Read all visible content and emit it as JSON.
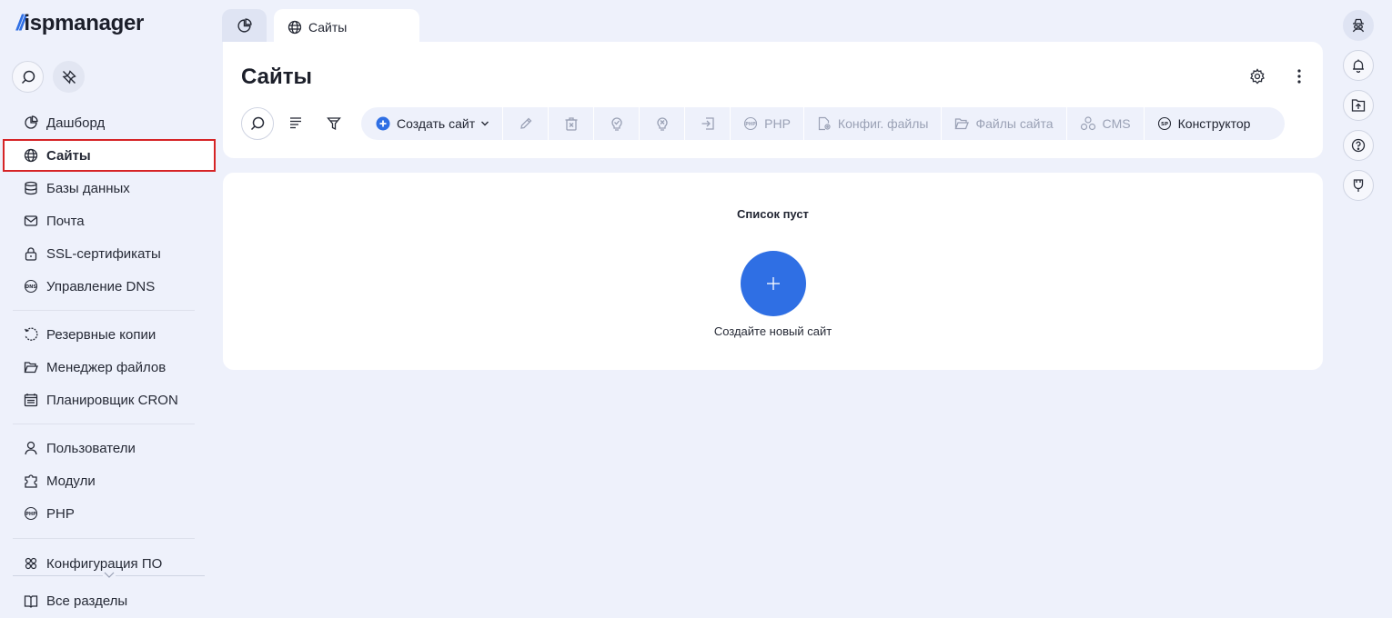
{
  "brand": {
    "slashes": "//",
    "name": "ispmanager"
  },
  "sidebar": {
    "tools": [
      {
        "icon": "search-icon"
      },
      {
        "icon": "pin-icon"
      }
    ],
    "items": [
      {
        "id": "dashboard",
        "label": "Дашборд",
        "icon": "pie-chart-icon"
      },
      {
        "id": "sites",
        "label": "Сайты",
        "icon": "globe-icon",
        "active": true
      },
      {
        "id": "databases",
        "label": "Базы данных",
        "icon": "database-icon"
      },
      {
        "id": "mail",
        "label": "Почта",
        "icon": "mail-icon"
      },
      {
        "id": "ssl",
        "label": "SSL-сертификаты",
        "icon": "lock-icon"
      },
      {
        "id": "dns",
        "label": "Управление DNS",
        "icon": "dns-icon"
      },
      {
        "id": "backups",
        "label": "Резервные копии",
        "icon": "backup-icon"
      },
      {
        "id": "files",
        "label": "Менеджер файлов",
        "icon": "folder-icon"
      },
      {
        "id": "cron",
        "label": "Планировщик CRON",
        "icon": "calendar-icon"
      },
      {
        "id": "users",
        "label": "Пользователи",
        "icon": "user-icon"
      },
      {
        "id": "modules",
        "label": "Модули",
        "icon": "puzzle-icon"
      },
      {
        "id": "php",
        "label": "PHP",
        "icon": "php-icon"
      },
      {
        "id": "software",
        "label": "Конфигурация ПО",
        "icon": "gear-cluster-icon"
      },
      {
        "id": "all",
        "label": "Все разделы",
        "icon": "book-icon"
      }
    ]
  },
  "tabs": [
    {
      "id": "home",
      "icon": "pie-chart-icon",
      "label": ""
    },
    {
      "id": "sites",
      "icon": "globe-icon",
      "label": "Сайты",
      "active": true
    }
  ],
  "header": {
    "title": "Сайты",
    "actions": [
      "settings-icon",
      "more-vertical-icon"
    ]
  },
  "toolbar": {
    "left": [
      "search-icon",
      "sort-icon",
      "filter-icon"
    ],
    "create_label": "Создать сайт",
    "icon_actions": [
      "edit-icon",
      "delete-icon",
      "enable-icon",
      "disable-icon",
      "login-icon"
    ],
    "php_label": "PHP",
    "config_label": "Конфиг. файлы",
    "files_label": "Файлы сайта",
    "cms_label": "CMS",
    "constructor_label": "Конструктор"
  },
  "empty_state": {
    "title": "Список пуст",
    "hint": "Создайте новый сайт"
  },
  "right_rail": [
    "user-spy-icon",
    "bell-icon",
    "upload-folder-icon",
    "help-icon",
    "plug-icon"
  ],
  "colors": {
    "accent": "#2f6fe4",
    "background": "#eef1fb",
    "highlight_border": "#d62426",
    "disabled_text": "#9aa1b5"
  }
}
